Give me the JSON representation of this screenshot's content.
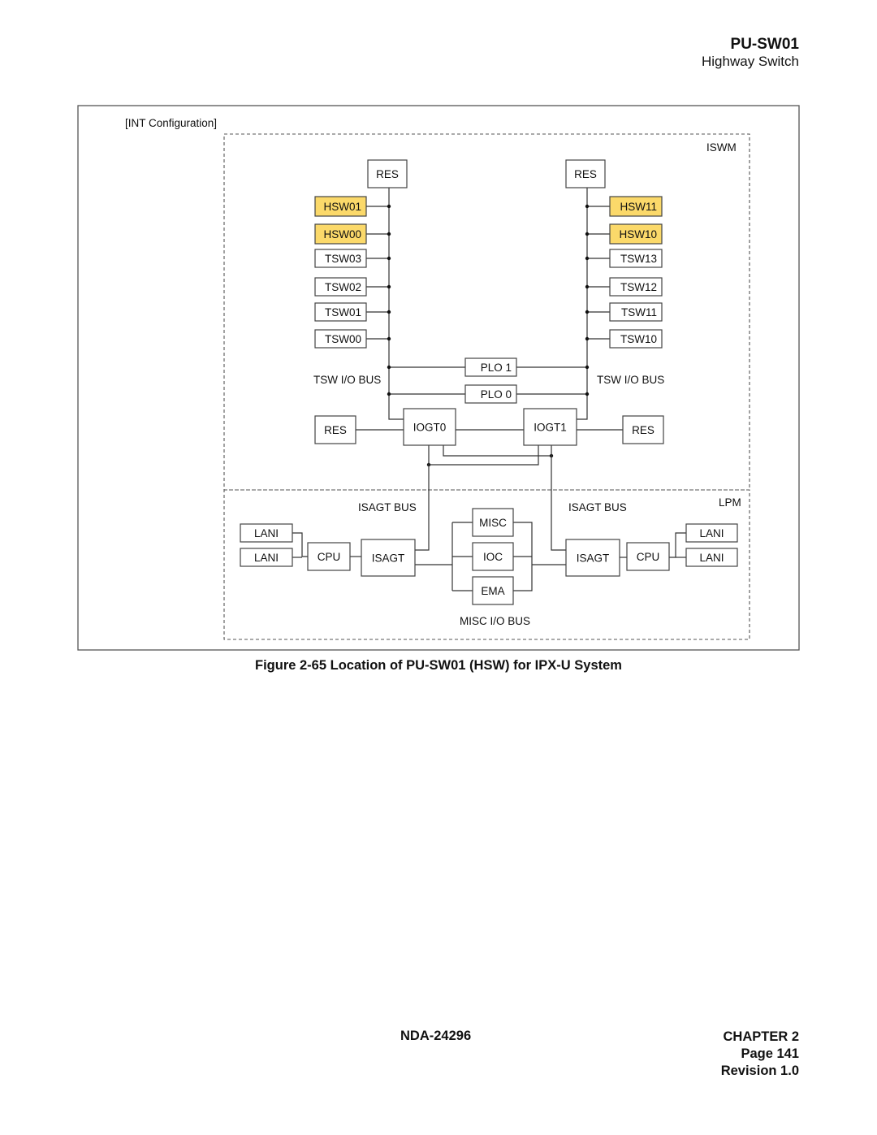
{
  "header": {
    "title": "PU-SW01",
    "subtitle": "Highway Switch"
  },
  "figure": {
    "config_label": "[INT Configuration]",
    "regions": {
      "iswm": "ISWM",
      "lpm": "LPM"
    },
    "colors": {
      "highlight_fill": "#FBD96A",
      "box_fill": "#FFFFFF",
      "line": "#333333"
    },
    "left_stack": {
      "res": "RES",
      "modules": [
        {
          "label": "HSW01",
          "highlight": true
        },
        {
          "label": "HSW00",
          "highlight": true
        },
        {
          "label": "TSW03",
          "highlight": false
        },
        {
          "label": "TSW02",
          "highlight": false
        },
        {
          "label": "TSW01",
          "highlight": false
        },
        {
          "label": "TSW00",
          "highlight": false
        }
      ]
    },
    "right_stack": {
      "res": "RES",
      "modules": [
        {
          "label": "HSW11",
          "highlight": true
        },
        {
          "label": "HSW10",
          "highlight": true
        },
        {
          "label": "TSW13",
          "highlight": false
        },
        {
          "label": "TSW12",
          "highlight": false
        },
        {
          "label": "TSW11",
          "highlight": false
        },
        {
          "label": "TSW10",
          "highlight": false
        }
      ]
    },
    "plo": [
      "PLO 1",
      "PLO 0"
    ],
    "bus_labels": {
      "tsw_left": "TSW I/O BUS",
      "tsw_right": "TSW I/O BUS",
      "isagt_left": "ISAGT BUS",
      "isagt_right": "ISAGT BUS",
      "misc": "MISC I/O BUS"
    },
    "iogt": [
      "IOGT0",
      "IOGT1"
    ],
    "iogt_res": [
      "RES",
      "RES"
    ],
    "lpm_left": {
      "lani": [
        "LANI",
        "LANI"
      ],
      "cpu": "CPU",
      "isagt": "ISAGT"
    },
    "lpm_center": [
      "MISC",
      "IOC",
      "EMA"
    ],
    "lpm_right": {
      "lani": [
        "LANI",
        "LANI"
      ],
      "cpu": "CPU",
      "isagt": "ISAGT"
    }
  },
  "caption": "Figure 2-65   Location of PU-SW01 (HSW) for IPX-U System",
  "footer": {
    "doc_number": "NDA-24296",
    "chapter": "CHAPTER 2",
    "page": "Page 141",
    "revision": "Revision 1.0"
  }
}
